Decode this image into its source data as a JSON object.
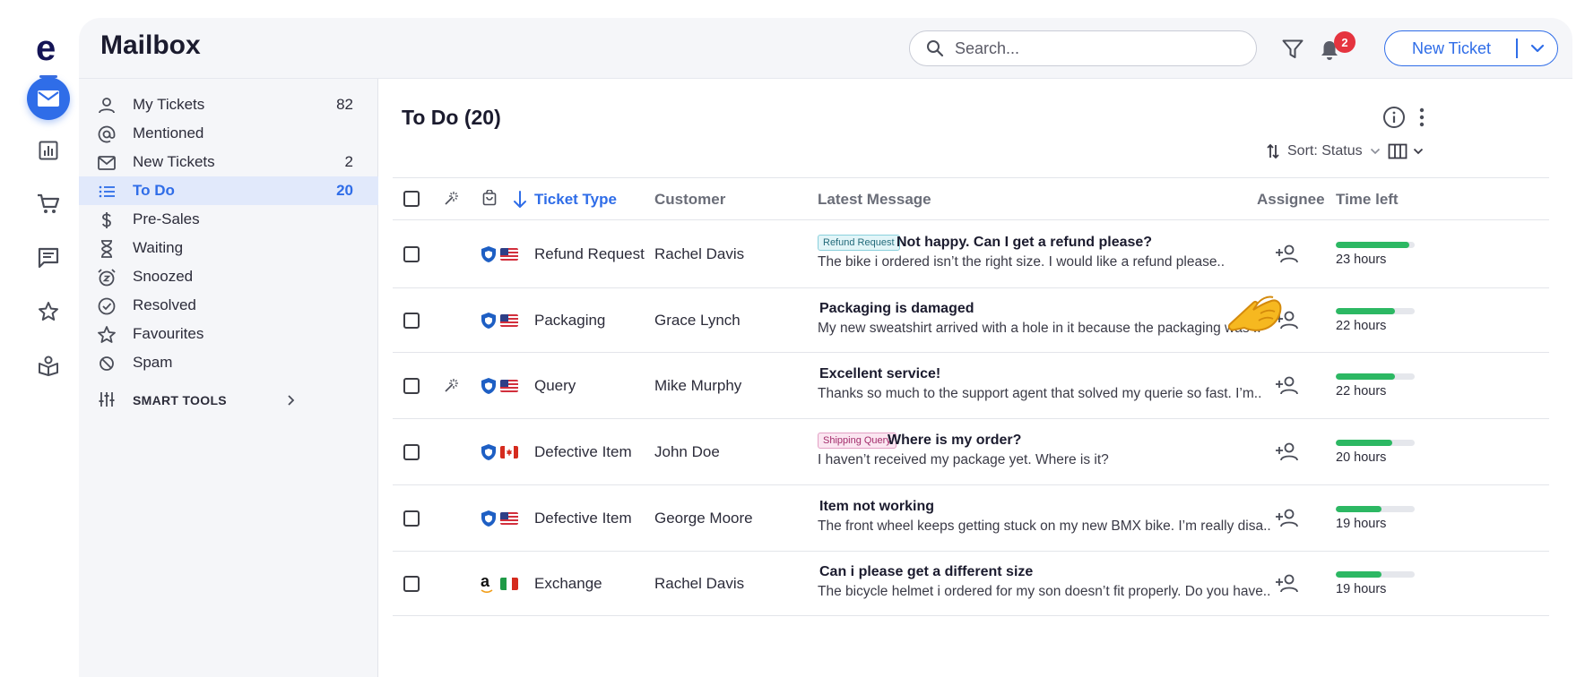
{
  "app": {
    "logo": "e",
    "title": "Mailbox"
  },
  "search": {
    "placeholder": "Search..."
  },
  "notifications": {
    "count": "2"
  },
  "new_ticket": {
    "label": "New Ticket"
  },
  "nav": {
    "items": [
      {
        "label": "My Tickets",
        "count": "82",
        "icon": "person-icon"
      },
      {
        "label": "Mentioned",
        "count": "",
        "icon": "at-icon"
      },
      {
        "label": "New Tickets",
        "count": "2",
        "icon": "envelope-icon"
      },
      {
        "label": "To Do",
        "count": "20",
        "icon": "list-icon",
        "active": true
      },
      {
        "label": "Pre-Sales",
        "count": "",
        "icon": "dollar-icon"
      },
      {
        "label": "Waiting",
        "count": "",
        "icon": "hourglass-icon"
      },
      {
        "label": "Snoozed",
        "count": "",
        "icon": "alarm-icon"
      },
      {
        "label": "Resolved",
        "count": "",
        "icon": "check-circle-icon"
      },
      {
        "label": "Favourites",
        "count": "",
        "icon": "star-icon"
      },
      {
        "label": "Spam",
        "count": "",
        "icon": "block-icon"
      }
    ],
    "smart_tools": "SMART TOOLS"
  },
  "content": {
    "title": "To Do (20)",
    "sort_label": "Sort: Status"
  },
  "table": {
    "columns": {
      "ticket_type": "Ticket Type",
      "customer": "Customer",
      "latest_message": "Latest Message",
      "assignee": "Assignee",
      "time_left": "Time left"
    },
    "rows": [
      {
        "channel": "shield",
        "flag": "us",
        "wand": false,
        "type": "Refund Request",
        "customer": "Rachel Davis",
        "tag": "Refund Request",
        "tag_kind": "refund",
        "title": "Not happy. Can I get a refund please?",
        "body": "The bike i ordered isn’t the right size. I would like a refund please..",
        "time": "23 hours",
        "progress": 0.93
      },
      {
        "channel": "shield",
        "flag": "us",
        "wand": false,
        "type": "Packaging",
        "customer": "Grace Lynch",
        "tag": "",
        "tag_kind": "",
        "title": "Packaging is damaged",
        "body": "My new sweatshirt arrived with a hole in it because the packaging was ..",
        "time": "22 hours",
        "progress": 0.75
      },
      {
        "channel": "shield",
        "flag": "us",
        "wand": true,
        "type": "Query",
        "customer": "Mike Murphy",
        "tag": "",
        "tag_kind": "",
        "title": "Excellent service!",
        "body": "Thanks so much to the support agent that solved my querie so fast. I’m..",
        "time": "22 hours",
        "progress": 0.75
      },
      {
        "channel": "shield",
        "flag": "ca",
        "wand": false,
        "type": "Defective Item",
        "customer": "John Doe",
        "tag": "Shipping Query",
        "tag_kind": "shipping",
        "title": "Where is my order?",
        "body": "I haven’t received my package yet. Where is it?",
        "time": "20 hours",
        "progress": 0.72
      },
      {
        "channel": "shield",
        "flag": "us",
        "wand": false,
        "type": "Defective Item",
        "customer": "George Moore",
        "tag": "",
        "tag_kind": "",
        "title": "Item not working",
        "body": "The front wheel keeps getting stuck on my new BMX bike. I’m really disa..",
        "time": "19 hours",
        "progress": 0.58
      },
      {
        "channel": "amazon",
        "flag": "it",
        "wand": false,
        "type": "Exchange",
        "customer": "Rachel Davis",
        "tag": "",
        "tag_kind": "",
        "title": "Can i please get a different size",
        "body": "The bicycle helmet i ordered for my son doesn’t fit properly. Do you have..",
        "time": "19 hours",
        "progress": 0.58
      }
    ]
  },
  "colors": {
    "accent": "#2f6de8",
    "progress": "#2cb863",
    "badge": "#e5343f"
  }
}
